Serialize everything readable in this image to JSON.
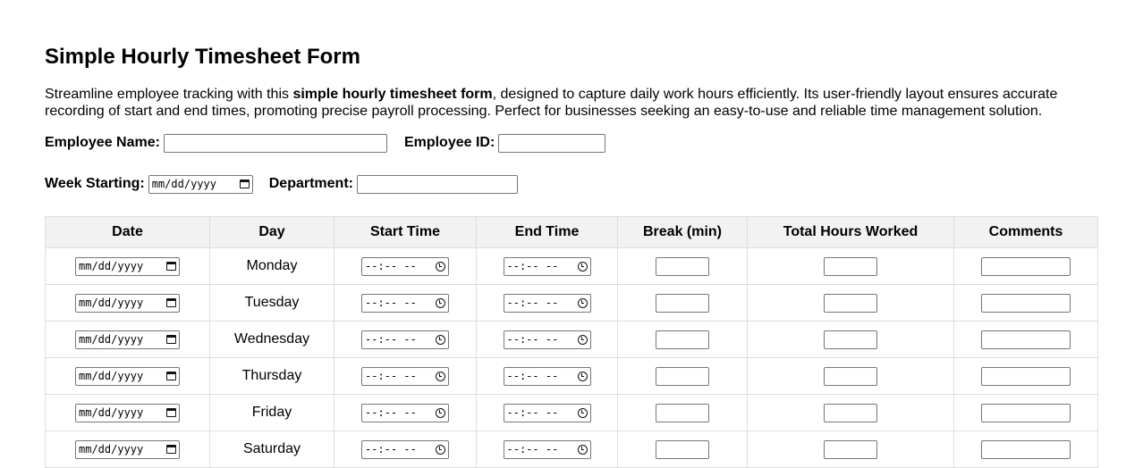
{
  "title": "Simple Hourly Timesheet Form",
  "description": {
    "before": "Streamline employee tracking with this ",
    "bold": "simple hourly timesheet form",
    "after": ", designed to capture daily work hours efficiently. Its user-friendly layout ensures accurate recording of start and end times, promoting precise payroll processing. Perfect for businesses seeking an easy-to-use and reliable time management solution."
  },
  "fields": {
    "employee_name_label": "Employee Name:",
    "employee_id_label": "Employee ID:",
    "week_starting_label": "Week Starting:",
    "department_label": "Department:",
    "date_placeholder": "mm/dd/yyyy",
    "time_placeholder": "--:-- --"
  },
  "table": {
    "headers": [
      "Date",
      "Day",
      "Start Time",
      "End Time",
      "Break (min)",
      "Total Hours Worked",
      "Comments"
    ],
    "days": [
      "Monday",
      "Tuesday",
      "Wednesday",
      "Thursday",
      "Friday",
      "Saturday"
    ]
  },
  "icons": {
    "date_picker": "calendar-icon",
    "time_picker": "clock-icon"
  }
}
